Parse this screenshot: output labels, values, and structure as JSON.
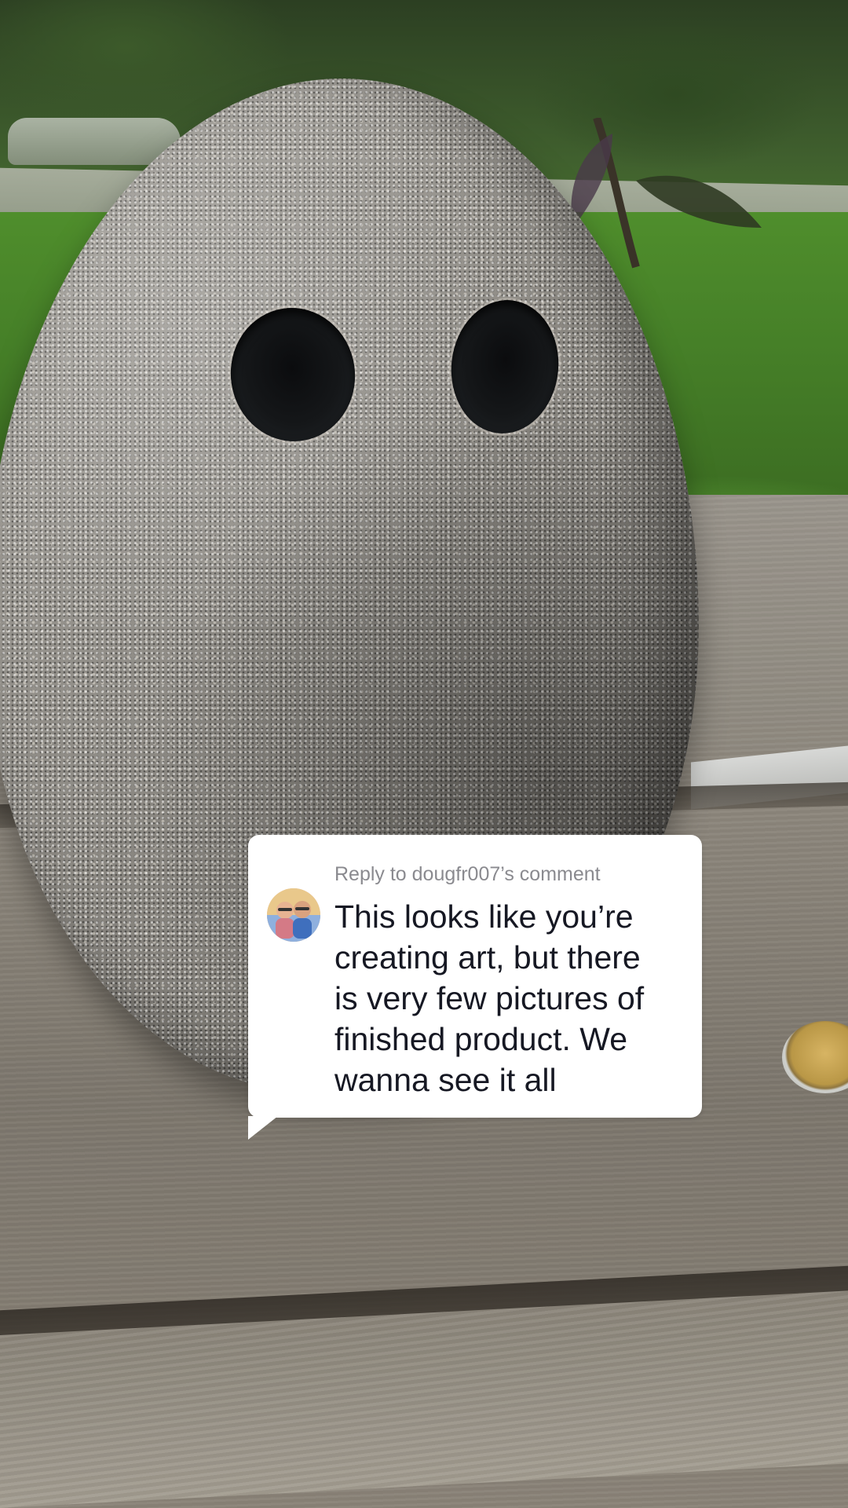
{
  "reply_sticker": {
    "header": "Reply to dougfr007’s comment",
    "avatar_alt": "dougfr007 profile photo",
    "comment_lines": [
      "This looks like you’re",
      "creating art, but there",
      "is very few pictures of",
      "finished product. We",
      "wanna see it all"
    ]
  },
  "colors": {
    "card_background": "#ffffff",
    "header_text": "#8a8a8f",
    "comment_text": "#161823"
  }
}
